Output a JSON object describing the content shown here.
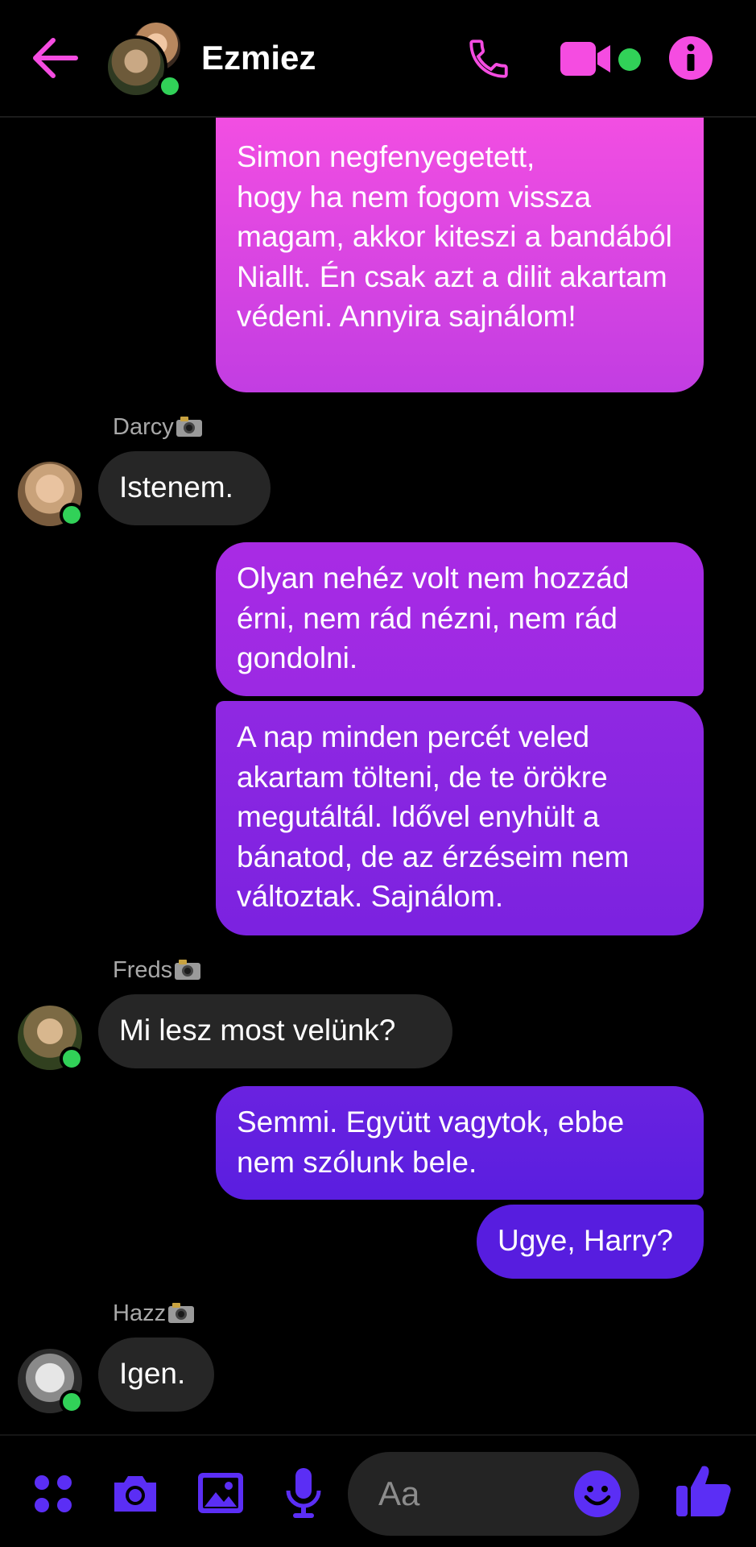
{
  "header": {
    "title": "Ezmiez",
    "back_icon": "arrow-left-icon",
    "call_icon": "phone-icon",
    "video_icon": "video-camera-icon",
    "info_icon": "info-icon",
    "accent": "#f54ce1",
    "online_color": "#31d158"
  },
  "messages": [
    {
      "type": "out",
      "text": "Simon negfenyegetett,\nhogy ha nem fogom vissza magam, akkor kiteszi a bandából Niallt. Én csak azt a dilit akartam védeni. Annyira sajnálom!"
    },
    {
      "type": "sender",
      "text": "Darcy"
    },
    {
      "type": "in",
      "text": "Istenem."
    },
    {
      "type": "out",
      "text": "Olyan nehéz volt nem hozzád érni, nem rád nézni, nem rád gondolni."
    },
    {
      "type": "out",
      "text": "A nap minden percét veled akartam tölteni, de te örökre megutáltál. Idővel enyhült a bánatod, de az érzéseim nem változtak. Sajnálom."
    },
    {
      "type": "sender",
      "text": "Freds"
    },
    {
      "type": "in",
      "text": "Mi lesz most velünk?"
    },
    {
      "type": "out",
      "text": "Semmi. Együtt vagytok, ebbe nem szólunk bele."
    },
    {
      "type": "out",
      "text": "Ugye, Harry?"
    },
    {
      "type": "sender",
      "text": "Hazz"
    },
    {
      "type": "in",
      "text": "Igen."
    }
  ],
  "composer": {
    "placeholder": "Aa",
    "accent": "#5b2ef5",
    "icons": [
      "menu-dots-icon",
      "camera-icon",
      "gallery-icon",
      "microphone-icon",
      "emoji-icon",
      "thumbs-up-icon"
    ]
  },
  "colors": {
    "gradient_top": "#f54ce1",
    "gradient_mid": "#a02ae6",
    "gradient_bottom": "#5a1ee0",
    "incoming_bg": "#262626"
  }
}
